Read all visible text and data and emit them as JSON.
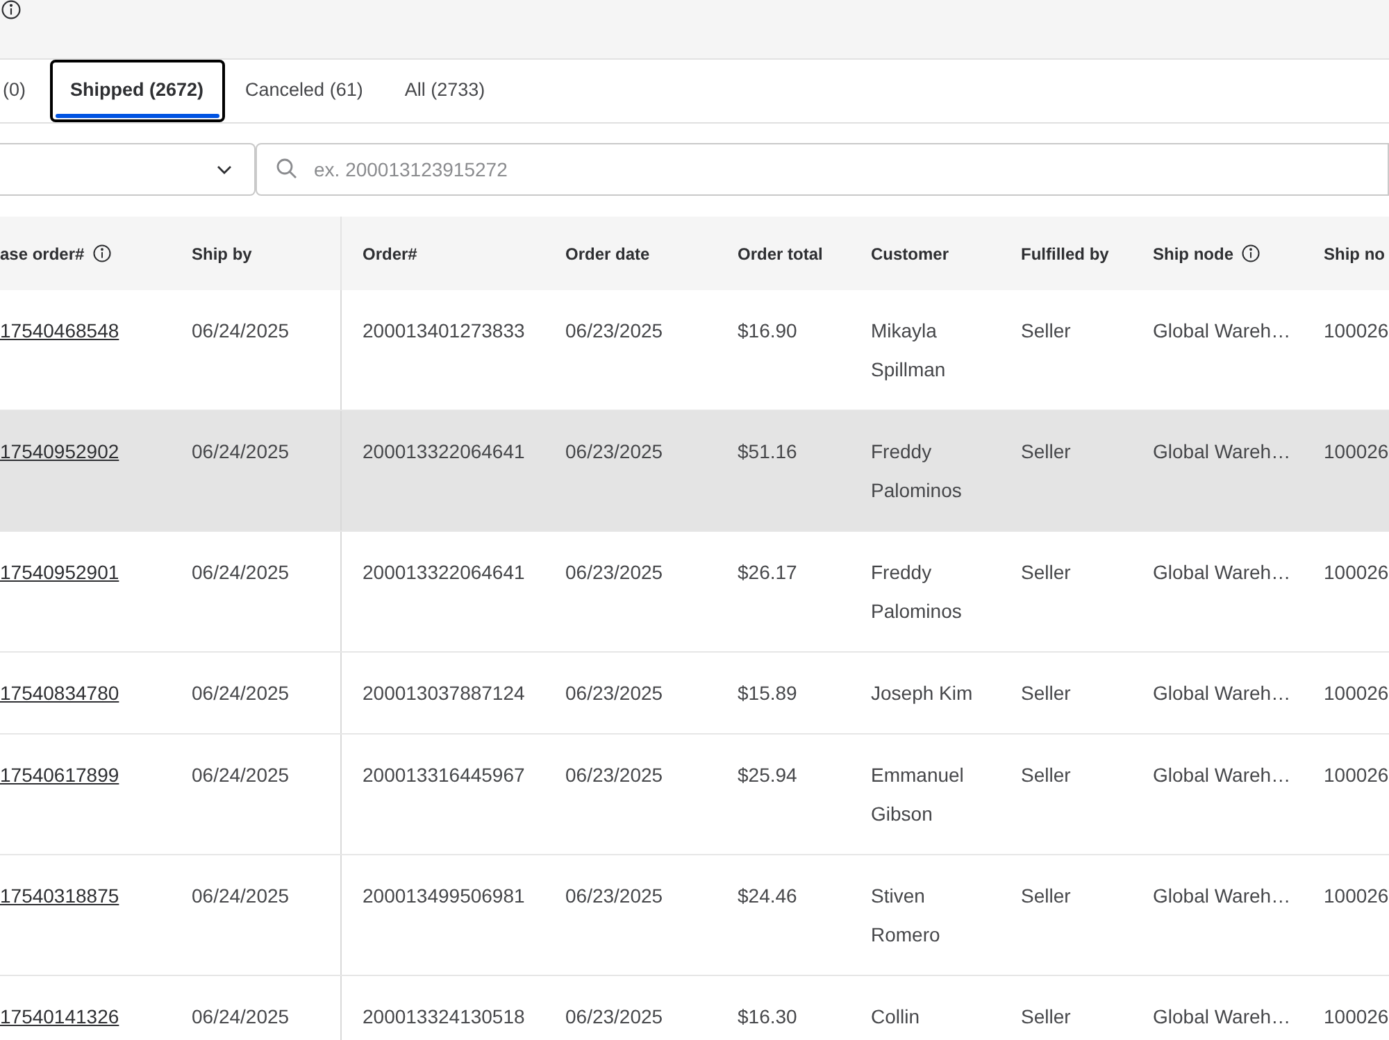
{
  "tabs": [
    {
      "label": "(0)",
      "selected": false
    },
    {
      "label": "Shipped (2672)",
      "selected": true
    },
    {
      "label": "Canceled (61)",
      "selected": false
    },
    {
      "label": "All (2733)",
      "selected": false
    }
  ],
  "search": {
    "placeholder": "ex. 200013123915272"
  },
  "table": {
    "columns": [
      {
        "label": "ase order#",
        "info": true,
        "kind": "link"
      },
      {
        "label": "Ship by",
        "info": false,
        "kind": "text"
      },
      {
        "label": "Order#",
        "info": false,
        "kind": "text"
      },
      {
        "label": "Order date",
        "info": false,
        "kind": "text"
      },
      {
        "label": "Order total",
        "info": false,
        "kind": "text"
      },
      {
        "label": "Customer",
        "info": false,
        "kind": "text"
      },
      {
        "label": "Fulfilled by",
        "info": false,
        "kind": "text"
      },
      {
        "label": "Ship node",
        "info": true,
        "kind": "text"
      },
      {
        "label": "Ship no",
        "info": false,
        "kind": "text"
      }
    ],
    "rows": [
      {
        "highlighted": false,
        "cells": [
          "17540468548",
          "06/24/2025",
          "200013401273833",
          "06/23/2025",
          "$16.90",
          "Mikayla Spillman",
          "Seller",
          "Global Wareh…",
          "100026"
        ]
      },
      {
        "highlighted": true,
        "cells": [
          "17540952902",
          "06/24/2025",
          "200013322064641",
          "06/23/2025",
          "$51.16",
          "Freddy Palominos",
          "Seller",
          "Global Wareh…",
          "100026"
        ]
      },
      {
        "highlighted": false,
        "cells": [
          "17540952901",
          "06/24/2025",
          "200013322064641",
          "06/23/2025",
          "$26.17",
          "Freddy Palominos",
          "Seller",
          "Global Wareh…",
          "100026"
        ]
      },
      {
        "highlighted": false,
        "cells": [
          "17540834780",
          "06/24/2025",
          "200013037887124",
          "06/23/2025",
          "$15.89",
          "Joseph Kim",
          "Seller",
          "Global Wareh…",
          "100026"
        ]
      },
      {
        "highlighted": false,
        "cells": [
          "17540617899",
          "06/24/2025",
          "200013316445967",
          "06/23/2025",
          "$25.94",
          "Emmanuel Gibson",
          "Seller",
          "Global Wareh…",
          "100026"
        ]
      },
      {
        "highlighted": false,
        "cells": [
          "17540318875",
          "06/24/2025",
          "200013499506981",
          "06/23/2025",
          "$24.46",
          "Stiven Romero",
          "Seller",
          "Global Wareh…",
          "100026"
        ]
      },
      {
        "highlighted": false,
        "cells": [
          "17540141326",
          "06/24/2025",
          "200013324130518",
          "06/23/2025",
          "$16.30",
          "Collin",
          "Seller",
          "Global Wareh…",
          "100026"
        ]
      }
    ]
  }
}
